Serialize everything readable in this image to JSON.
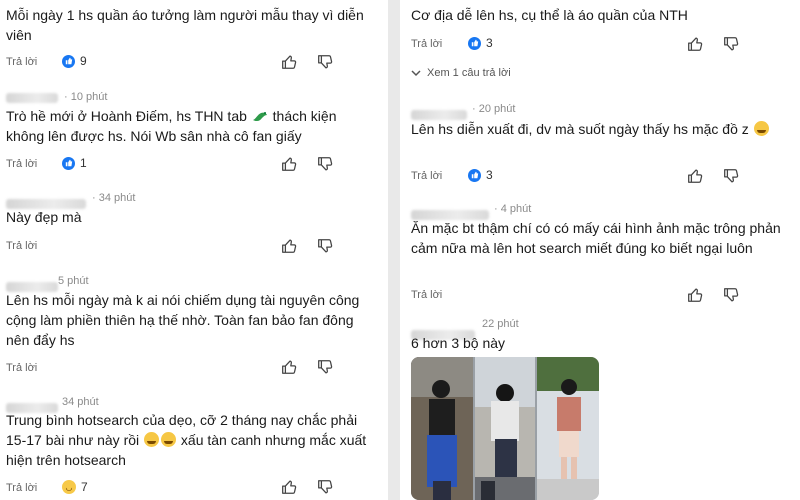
{
  "ui": {
    "reply_label": "Trả lời",
    "view_replies_label": "Xem 1 câu trả lời"
  },
  "left": {
    "c1": {
      "text": "Mỗi ngày 1 hs quần áo tưởng làm người mẫu thay vì diễn viên",
      "count": "9"
    },
    "c2": {
      "time": "10 phút",
      "text_a": "Trò hề mới ở Hoành Điếm, hs THN tab",
      "text_b": "thách kiện không lên được hs. Nói Wb sân nhà cô fan giấy",
      "count": "1"
    },
    "c3": {
      "time": "34 phút",
      "text": "Này đẹp mà"
    },
    "c4": {
      "time": "5 phút",
      "text": "Lên hs mỗi ngày mà k ai nói chiếm dụng tài nguyên công cộng làm phiền thiên hạ thế nhờ. Toàn fan bảo fan đông nên đẩy hs"
    },
    "c5": {
      "time": "34 phút",
      "text_a": "Trung bình hotsearch của dẹo, cỡ 2 tháng nay chắc phải 15-17 bài như này rồi",
      "text_b": "xấu tàn canh nhưng mắc xuất hiện trên hotsearch",
      "count": "7"
    }
  },
  "right": {
    "c1": {
      "text": "Cơ địa dễ lên hs, cụ thể là áo quần của NTH",
      "count": "3"
    },
    "c2": {
      "time": "20 phút",
      "text": "Lên hs diễn xuất đi, dv mà suốt ngày thấy hs mặc đồ z",
      "count": "3"
    },
    "c3": {
      "time": "4 phút",
      "text": "Ăn mặc bt thậm chí có có mấy cái hình ảnh mặc trông phản cảm nữa mà lên hot search miết đúng ko biết ngại luôn"
    },
    "c4": {
      "time": "22 phút",
      "text": "6 hơn 3 bộ này"
    }
  },
  "colors": {
    "like_blue": "#1877f2",
    "laugh_yellow": "#f7c948",
    "divider": "#e9e9e9"
  }
}
